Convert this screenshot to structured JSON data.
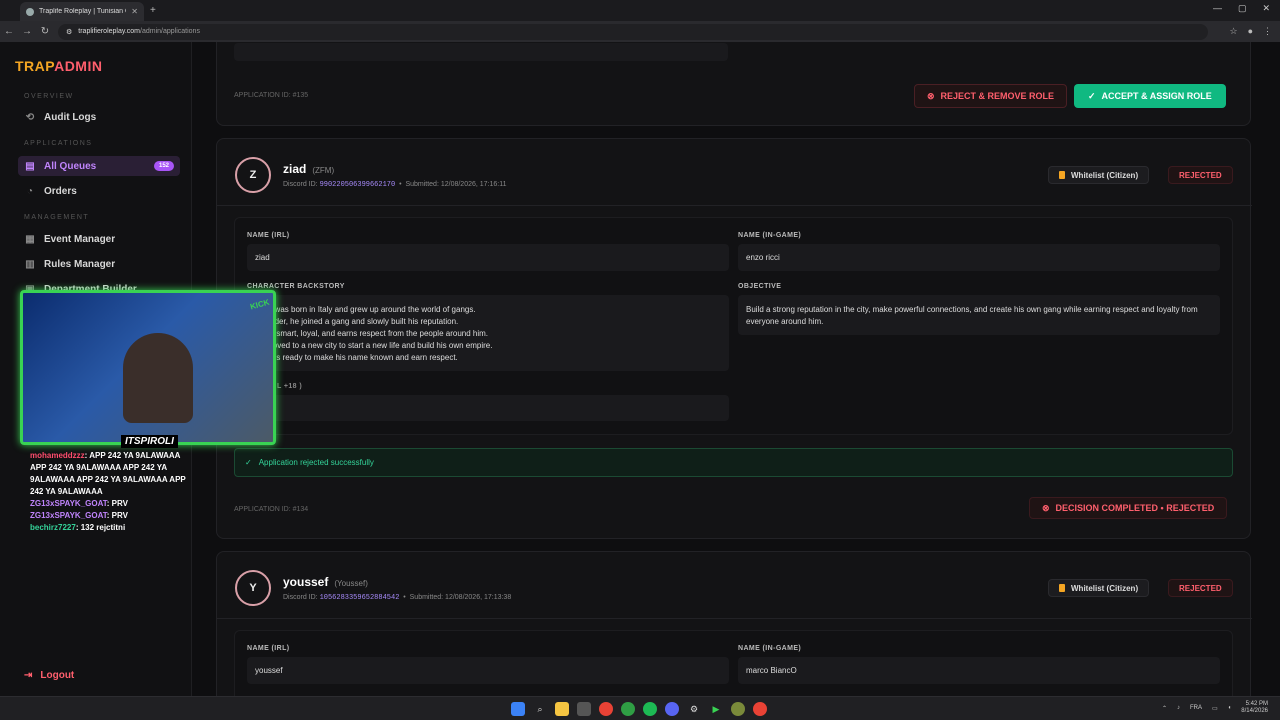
{
  "browser": {
    "tab_title": "Traplife Roleplay | Tunisian GTA",
    "url_domain": "traplifieroleplay.com",
    "url_path": "/admin/applications"
  },
  "sidebar": {
    "brand_part1": "TRAP",
    "brand_part2": "ADMIN",
    "sections": {
      "overview": "OVERVIEW",
      "applications": "APPLICATIONS",
      "management": "MANAGEMENT"
    },
    "items": {
      "audit_logs": "Audit Logs",
      "all_queues": "All Queues",
      "all_queues_badge": "152",
      "orders": "Orders",
      "event_manager": "Event Manager",
      "rules_manager": "Rules Manager",
      "department_builder": "Department Builder"
    },
    "logout": "Logout"
  },
  "card_top": {
    "application_id": "APPLICATION ID: #135",
    "reject_button": "REJECT & REMOVE ROLE",
    "accept_button": "ACCEPT & ASSIGN ROLE"
  },
  "card_ziad": {
    "avatar": "Z",
    "name": "ziad",
    "alias": "(ZFM)",
    "discord_label": "Discord ID:",
    "discord_id": "990220506399662170",
    "submitted": "Submitted: 12/08/2026, 17:16:11",
    "whitelist": "Whitelist (Citizen)",
    "status": "REJECTED",
    "name_irl_label": "NAME (IRL)",
    "name_irl": "ziad",
    "name_ingame_label": "NAME (IN-GAME)",
    "name_ingame": "enzo ricci",
    "backstory_label": "CHARACTER BACKSTORY",
    "backstory": "Ricci was born in Italy and grew up around the world of gangs.\ngot older, he joined a gang and slowly built his reputation.\ncalm, smart, loyal, and earns respect from the people around him.\nhe moved to a new city to start a new life and build his own empire.\nenzo is ready to make his name known and earn respect.",
    "objective_label": "OBJECTIVE",
    "objective": "Build a strong reputation in the city, make powerful connections, and create his own gang while earning respect and loyalty from everyone around him.",
    "partial_label": "L +18 )",
    "success_message": "Application rejected successfully",
    "application_id": "APPLICATION ID: #134",
    "decision": "DECISION COMPLETED • REJECTED"
  },
  "card_youssef": {
    "avatar": "Y",
    "name": "youssef",
    "alias": "(Youssef)",
    "discord_label": "Discord ID:",
    "discord_id": "1056283359652884542",
    "submitted": "Submitted: 12/08/2026, 17:13:38",
    "whitelist": "Whitelist (Citizen)",
    "status": "REJECTED",
    "name_irl_label": "NAME (IRL)",
    "name_irl": "youssef",
    "name_ingame_label": "NAME (IN-GAME)",
    "name_ingame": "marco BiancO"
  },
  "overlay": {
    "streamer": "ITSPIROLI",
    "kick": "KICK",
    "chat": [
      {
        "user": "mohameddzzz",
        "msg": ": APP 242 YA 9ALAWAAA APP 242 YA 9ALAWAAA APP 242 YA 9ALAWAAA APP 242 YA 9ALAWAAA APP 242 YA 9ALAWAAA"
      },
      {
        "user": "ZG13xSPAYK_GOAT",
        "msg": ": PRV"
      },
      {
        "user": "ZG13xSPAYK_GOAT",
        "msg": ": PRV"
      },
      {
        "user": "bechirz7227",
        "msg": ": 132 rejctitni"
      }
    ]
  },
  "taskbar": {
    "lang": "FRA",
    "time": "5:42 PM",
    "date": "8/14/2026"
  },
  "colors": {
    "accent_purple": "#a855f7",
    "accent_green": "#10b981",
    "reject_red": "#ff5f6d",
    "brand_orange": "#f5a623"
  }
}
